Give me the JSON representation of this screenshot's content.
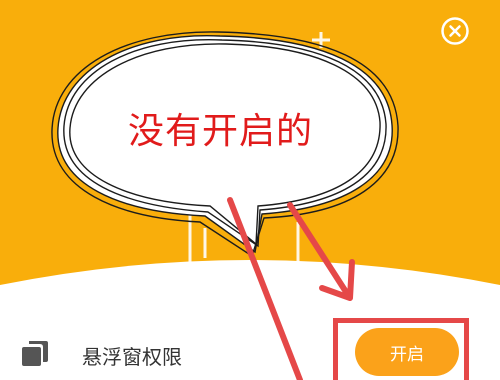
{
  "annotation": {
    "bubble_text": "没有开启的"
  },
  "permission": {
    "label": "悬浮窗权限",
    "icon": "overlay-window-icon",
    "enable_label": "开启"
  },
  "dialog": {
    "close_icon": "close-circle-icon"
  },
  "colors": {
    "header_bg": "#f9ae0b",
    "button_bg": "#fba21a",
    "annotation_red": "#e54848",
    "bubble_text": "#e11b1b"
  }
}
